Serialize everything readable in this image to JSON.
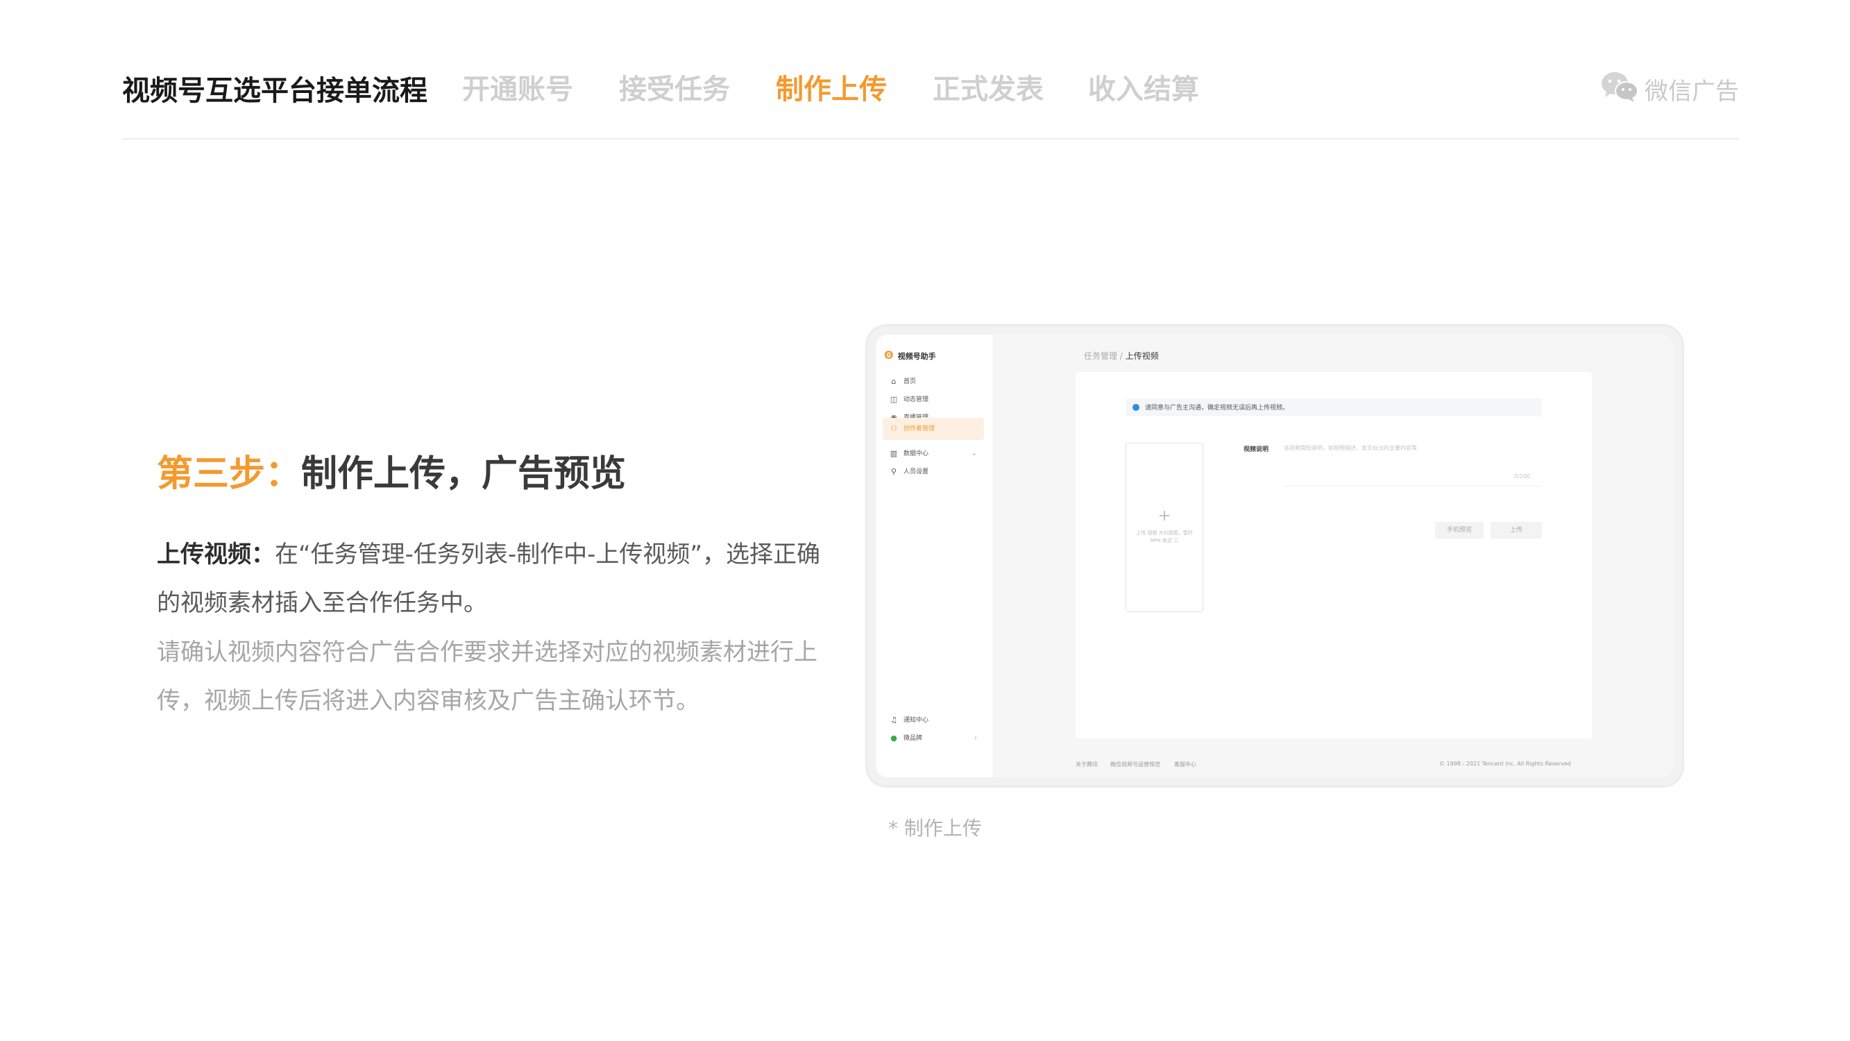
{
  "header": {
    "title": "视频号互选平台接单流程",
    "steps": [
      {
        "label": "开通账号",
        "active": false
      },
      {
        "label": "接受任务",
        "active": false
      },
      {
        "label": "制作上传",
        "active": true
      },
      {
        "label": "正式发表",
        "active": false
      },
      {
        "label": "收入结算",
        "active": false
      }
    ],
    "brand": "微信广告",
    "brand_icon": "wechat-icon"
  },
  "content": {
    "step_no": "第三步：",
    "step_title": "制作上传，广告预览",
    "p1_lead": "上传视频：",
    "p1_text": "在“任务管理-任务列表-制作中-上传视频”，选择正确的视频素材插入至合作任务中。",
    "p2_text": "请确认视频内容符合广告合作要求并选择对应的视频素材进行上传，视频上传后将进入内容审核及广告主确认环节。"
  },
  "mock": {
    "app_name": "视频号助手",
    "menu": [
      {
        "label": "首页",
        "icon": "home-icon",
        "glyph": "⌂"
      },
      {
        "label": "动态管理",
        "icon": "camera-icon",
        "glyph": "◫"
      },
      {
        "label": "直播管理",
        "icon": "live-icon",
        "glyph": "◉"
      },
      {
        "label": "创作者管理",
        "icon": "creator-icon",
        "glyph": "⚇"
      },
      {
        "label": "数据中心",
        "icon": "chart-icon",
        "glyph": "▥",
        "chevron": "⌄"
      },
      {
        "label": "人员设置",
        "icon": "person-icon",
        "glyph": "⚲"
      }
    ],
    "bottom_menu": [
      {
        "label": "通知中心",
        "icon": "bell-icon",
        "glyph": "♫"
      },
      {
        "label": "微品牌",
        "icon": "brand-icon",
        "glyph": "●",
        "chevron": "›"
      }
    ],
    "breadcrumb_parent": "任务管理",
    "breadcrumb_sep": " / ",
    "breadcrumb_current": "上传视频",
    "notice": "请同意与广告主沟通，确定视频无误后再上传视频。",
    "upload_plus": "+",
    "upload_hint": "上传 视频 大约原图，暂时 MP4 格式 二",
    "field_label": "视频说明",
    "field_placeholder": "该视频简短说明，如视频描述，发文标注的主要内容等",
    "field_count": "0/200",
    "btn_preview": "手机预览",
    "btn_upload": "上传",
    "footer_links": [
      "关于腾讯",
      "微信视频号运营规范",
      "客服中心"
    ],
    "copyright": "© 1998 - 2021 Tencent Inc. All Rights Reserved"
  },
  "caption": "* 制作上传",
  "colors": {
    "accent": "#f39a2e",
    "muted": "#cfcfcf",
    "text": "#3a3a3a"
  }
}
